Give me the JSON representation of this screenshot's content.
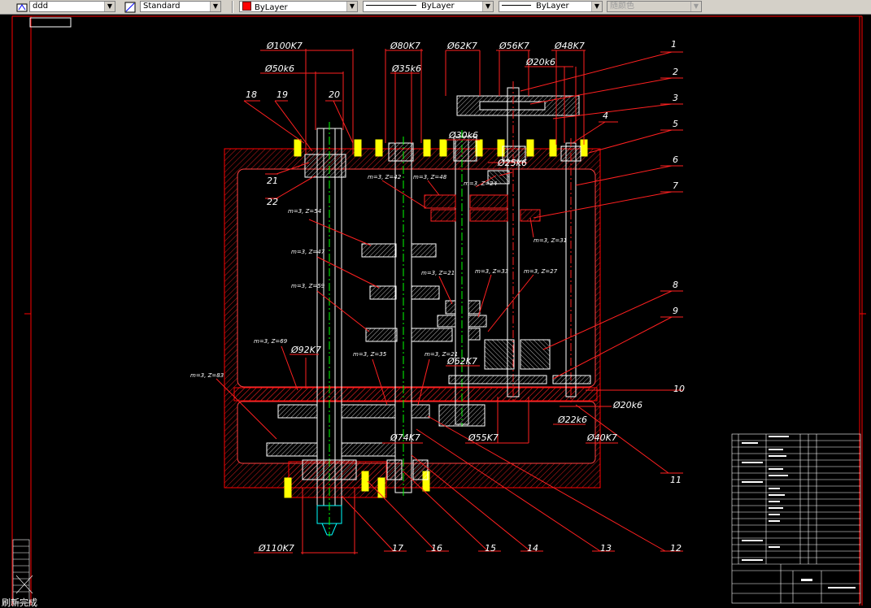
{
  "toolbar": {
    "text_style_name": "ddd",
    "dim_style_name": "Standard",
    "layer_color_label": "ByLayer",
    "linetype_label": "ByLayer",
    "lineweight_label": "ByLayer",
    "plot_style_label": "随颜色",
    "colors": {
      "accent_red": "#ff0000",
      "toolbar_bg": "#d4d0c8"
    }
  },
  "drawing": {
    "dimensions": {
      "d100": "Ø100K7",
      "d50": "Ø50k6",
      "d80": "Ø80K7",
      "d35": "Ø35k6",
      "d62a": "Ø62K7",
      "d56": "Ø56K7",
      "d20a": "Ø20k6",
      "d48": "Ø48K7",
      "d30": "Ø30k6",
      "d25": "Ø25k6",
      "d92": "Ø92K7",
      "d62b": "Ø62K7",
      "d74": "Ø74K7",
      "d55": "Ø55K7",
      "d20b": "Ø20k6",
      "d22": "Ø22k6",
      "d40": "Ø40K7",
      "d110": "Ø110K7"
    },
    "gear_labels": {
      "g42": "m=3, Z=42",
      "g48": "m=3, Z=48",
      "g24": "m=3, Z=24",
      "g31": "m=3, Z=31",
      "g54": "m=3, Z=54",
      "g47": "m=3, Z=47",
      "g59": "m=3, Z=59",
      "g21a": "m=3, Z=21",
      "g33": "m=3, Z=33",
      "g27": "m=3, Z=27",
      "g69": "m=3, Z=69",
      "g35": "m=3, Z=35",
      "g21b": "m=3, Z=21",
      "g83": "m=3, Z=83"
    },
    "balloons": {
      "b1": "1",
      "b2": "2",
      "b3": "3",
      "b4": "4",
      "b5": "5",
      "b6": "6",
      "b7": "7",
      "b8": "8",
      "b9": "9",
      "b10": "10",
      "b11": "11",
      "b12": "12",
      "b13": "13",
      "b14": "14",
      "b15": "15",
      "b16": "16",
      "b17": "17",
      "b18": "18",
      "b19": "19",
      "b20": "20",
      "b21": "21",
      "b22": "22"
    }
  },
  "command_line": "刷新完成"
}
